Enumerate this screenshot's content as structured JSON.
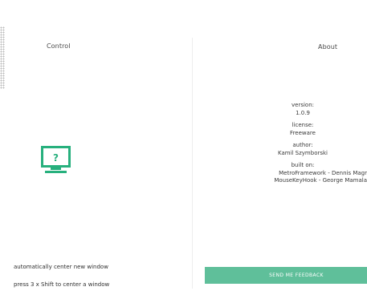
{
  "control": {
    "heading": "Control",
    "options": [
      "automatically center new window",
      "press 3 x Shift to center a window"
    ]
  },
  "monitor_icon": {
    "name": "monitor-question-icon",
    "glyph": "?",
    "color": "#27b07d"
  },
  "about": {
    "heading": "About",
    "version_label": "version:",
    "version_value": "1.0.9",
    "license_label": "license:",
    "license_value": "Freeware",
    "author_label": "author:",
    "author_value": "Kamil Szymborski",
    "builton_label": "built on:",
    "builton_items": [
      "MetroFramework - Dennis Magr",
      "MouseKeyHook - George Mamala"
    ]
  },
  "feedback": {
    "label": "SEND ME FEEDBACK",
    "color": "#5fbf9a"
  }
}
